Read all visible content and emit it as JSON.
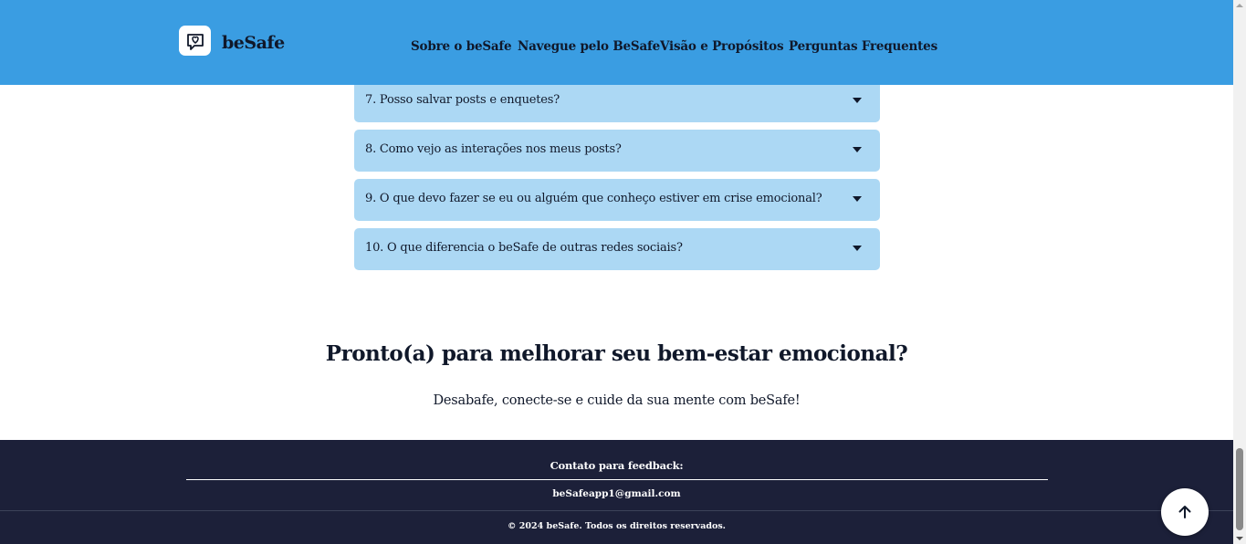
{
  "header": {
    "brand": "beSafe",
    "logo_icon": "heart-chat-icon",
    "bg_color": "#3a9de2",
    "nav": [
      {
        "label": "Sobre o beSafe"
      },
      {
        "label": "Navegue pelo BeSafe"
      },
      {
        "label": "Visão e Propósitos"
      },
      {
        "label": "Perguntas Frequentes"
      }
    ]
  },
  "faq": {
    "item_color": "#acd8f4",
    "items": [
      {
        "question": "7. Posso salvar posts e enquetes?"
      },
      {
        "question": "8. Como vejo as interações nos meus posts?"
      },
      {
        "question": "9. O que devo fazer se eu ou alguém que conheço estiver em crise emocional?"
      },
      {
        "question": "10. O que diferencia o beSafe de outras redes sociais?"
      }
    ]
  },
  "cta": {
    "title": "Pronto(a) para melhorar seu bem-estar emocional?",
    "subtitle": "Desabafe, conecte-se e cuide da sua mente com beSafe!"
  },
  "footer": {
    "bg_color": "#1c2039",
    "contact_label": "Contato para feedback:",
    "email": "beSafeapp1@gmail.com",
    "copyright": "© 2024 beSafe. Todos os direitos reservados."
  },
  "back_to_top": {
    "icon": "arrow-up-icon"
  }
}
